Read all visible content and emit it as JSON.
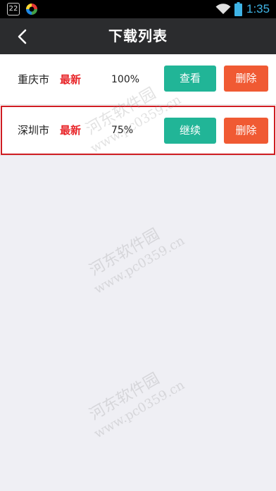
{
  "status_bar": {
    "notification_count": "22",
    "time": "1:35"
  },
  "header": {
    "title": "下载列表"
  },
  "downloads": [
    {
      "city": "重庆市",
      "tag": "最新",
      "progress": "100%",
      "action_label": "查看",
      "delete_label": "删除",
      "selected": false
    },
    {
      "city": "深圳市",
      "tag": "最新",
      "progress": "75%",
      "action_label": "继续",
      "delete_label": "删除",
      "selected": true
    }
  ],
  "watermark": {
    "text": "河东软件园",
    "url": "www.pc0359.cn"
  },
  "colors": {
    "header_bg": "#2b2c2e",
    "primary_button": "#21b597",
    "delete_button": "#f05a33",
    "tag_red": "#e8262a",
    "selection_outline": "#cf1c22",
    "page_bg": "#efeff4",
    "time_blue": "#3fb4e6"
  },
  "icons": {
    "back": "chevron-left-icon",
    "wifi": "wifi-icon",
    "battery": "battery-icon",
    "notification": "notification-icon",
    "app": "app-icon"
  }
}
